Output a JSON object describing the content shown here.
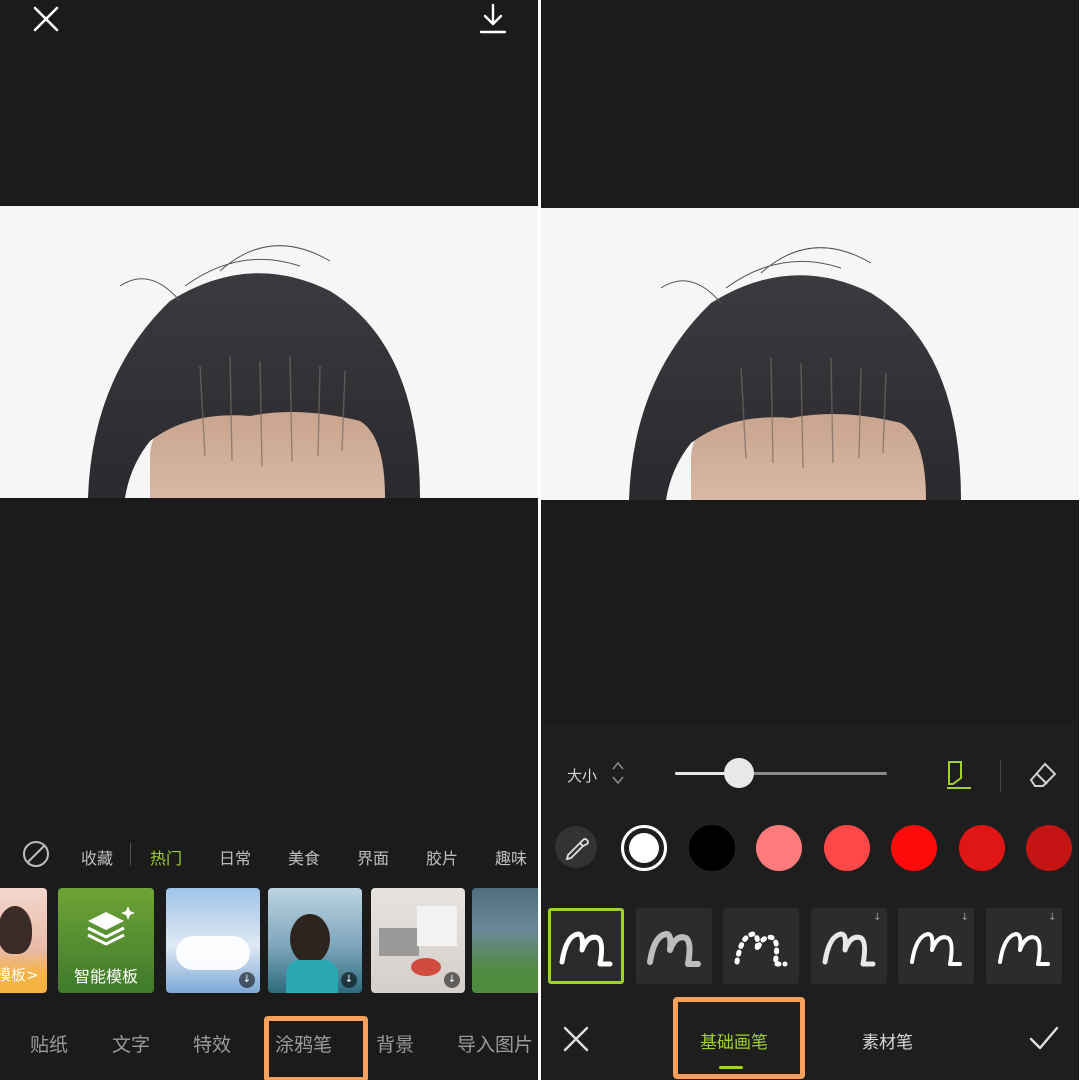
{
  "left_panel": {
    "categories": [
      {
        "label": "收藏",
        "active": false
      },
      {
        "label": "热门",
        "active": true
      },
      {
        "label": "日常",
        "active": false
      },
      {
        "label": "美食",
        "active": false
      },
      {
        "label": "界面",
        "active": false
      },
      {
        "label": "胶片",
        "active": false
      },
      {
        "label": "趣味",
        "active": false
      }
    ],
    "thumbnails": [
      {
        "label": "模板>"
      },
      {
        "label": "智能模板"
      },
      {
        "label": ""
      },
      {
        "label": ""
      },
      {
        "label": ""
      },
      {
        "label": ""
      }
    ],
    "tabs": [
      {
        "label": "贴纸"
      },
      {
        "label": "文字"
      },
      {
        "label": "特效"
      },
      {
        "label": "涂鸦笔"
      },
      {
        "label": "背景"
      },
      {
        "label": "导入图片"
      }
    ],
    "highlighted_tab": "涂鸦笔"
  },
  "right_panel": {
    "size_label": "大小",
    "size_value": 0.3,
    "colors": [
      "#ffffff",
      "#000000",
      "#ff7a7a",
      "#ff4848",
      "#ff0a0a",
      "#e01616",
      "#c41414"
    ],
    "selected_color": "#ffffff",
    "brush_count": 6,
    "selected_brush": 0,
    "bottom_tabs": [
      {
        "label": "基础画笔",
        "active": true
      },
      {
        "label": "素材笔",
        "active": false
      }
    ]
  },
  "colors": {
    "accent": "#9fd22e",
    "highlight_box": "#f7a15a",
    "panel_bg": "#1b1b1b"
  }
}
